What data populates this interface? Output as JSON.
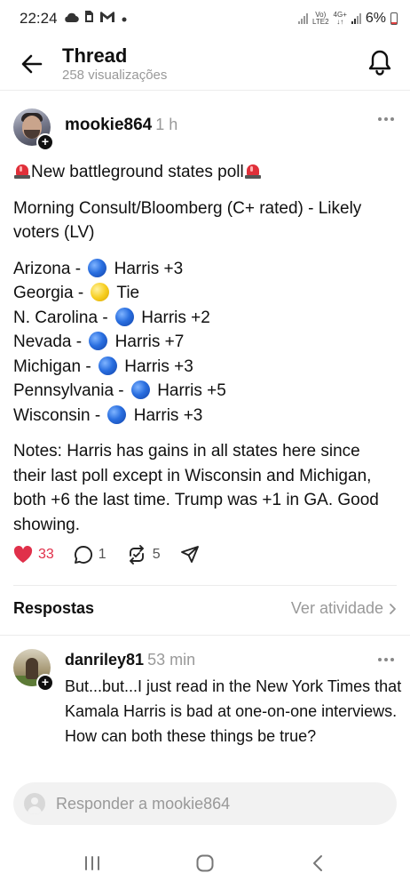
{
  "status_bar": {
    "time": "22:24",
    "network_top": "Vo)",
    "network_bottom": "LTE2",
    "data_type": "4G+",
    "battery": "6%"
  },
  "header": {
    "title": "Thread",
    "subtitle": "258 visualizações"
  },
  "post": {
    "author": "mookie864",
    "time": "1 h",
    "headline": "New battleground states poll",
    "source": "Morning Consult/Bloomberg (C+ rated) - Likely voters (LV)",
    "states": [
      {
        "name": "Arizona -",
        "dot": "blue",
        "result": "Harris +3"
      },
      {
        "name": "Georgia -",
        "dot": "yellow",
        "result": "Tie"
      },
      {
        "name": "N. Carolina -",
        "dot": "blue",
        "result": "Harris +2"
      },
      {
        "name": "Nevada -",
        "dot": "blue",
        "result": "Harris +7"
      },
      {
        "name": "Michigan -",
        "dot": "blue",
        "result": "Harris +3"
      },
      {
        "name": "Pennsylvania -",
        "dot": "blue",
        "result": "Harris +5"
      },
      {
        "name": "Wisconsin -",
        "dot": "blue",
        "result": "Harris +3"
      }
    ],
    "notes": "Notes: Harris has gains in all states here since their last poll except in Wisconsin and Michigan, both +6 the last time. Trump was +1 in GA. Good showing.",
    "likes": "33",
    "comments": "1",
    "reposts": "5"
  },
  "replies_section": {
    "title": "Respostas",
    "activity_link": "Ver atividade"
  },
  "reply": {
    "author": "danriley81",
    "time": "53 min",
    "text": "But...but...I just read in the New York Times that Kamala Harris is bad at one-on-one interviews. How can both these things be true?"
  },
  "composer": {
    "placeholder": "Responder a mookie864"
  },
  "colors": {
    "like": "#e0304a",
    "muted": "#999999",
    "text": "#101010"
  }
}
